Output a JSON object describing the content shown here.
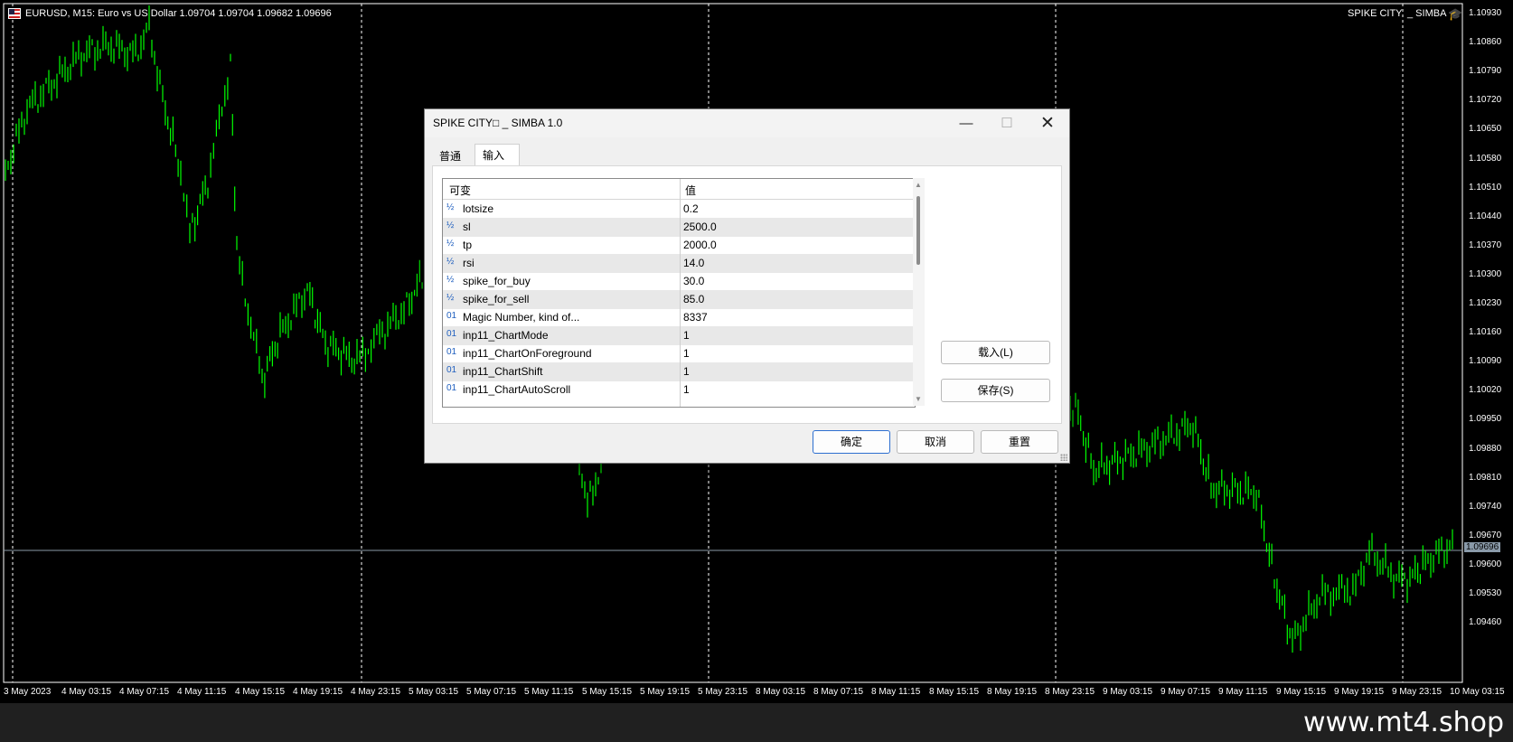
{
  "chart": {
    "header": "EURUSD, M15:  Euro vs US Dollar  1.09704 1.09704 1.09682 1.09696",
    "ea_name": "SPIKE CITY",
    "ea_author": "_ SIMBA",
    "ea_icon": "graduation-cap-icon",
    "current_price": "1.09696",
    "price_ticks": [
      "1.10930",
      "1.10860",
      "1.10790",
      "1.10720",
      "1.10650",
      "1.10580",
      "1.10510",
      "1.10440",
      "1.10370",
      "1.10300",
      "1.10230",
      "1.10160",
      "1.10090",
      "1.10020",
      "1.09950",
      "1.09880",
      "1.09810",
      "1.09740",
      "1.09670",
      "1.09600",
      "1.09530",
      "1.09460"
    ],
    "time_ticks": [
      "3 May 2023",
      "4 May 03:15",
      "4 May 07:15",
      "4 May 11:15",
      "4 May 15:15",
      "4 May 19:15",
      "4 May 23:15",
      "5 May 03:15",
      "5 May 07:15",
      "5 May 11:15",
      "5 May 15:15",
      "5 May 19:15",
      "5 May 23:15",
      "8 May 03:15",
      "8 May 07:15",
      "8 May 11:15",
      "8 May 15:15",
      "8 May 19:15",
      "8 May 23:15",
      "9 May 03:15",
      "9 May 07:15",
      "9 May 11:15",
      "9 May 15:15",
      "9 May 19:15",
      "9 May 23:15",
      "10 May 03:15"
    ],
    "colors": {
      "background": "#000000",
      "candles": "#00ff00",
      "grid": "#ffffff",
      "price_line": "#8a9aa9"
    }
  },
  "dialog": {
    "title": "SPIKE CITY□ _ SIMBA 1.0",
    "window_buttons": {
      "minimize": "—",
      "maximize": "☐",
      "close": "✕"
    },
    "tabs": [
      {
        "label": "普通"
      },
      {
        "label": "输入"
      }
    ],
    "active_tab": "输入",
    "grid": {
      "col_variable": "可变",
      "col_value": "值",
      "rows": [
        {
          "icon": "½",
          "name": "lotsize",
          "value": "0.2"
        },
        {
          "icon": "½",
          "name": "sl",
          "value": "2500.0"
        },
        {
          "icon": "½",
          "name": "tp",
          "value": "2000.0"
        },
        {
          "icon": "½",
          "name": "rsi",
          "value": "14.0"
        },
        {
          "icon": "½",
          "name": "spike_for_buy",
          "value": "30.0"
        },
        {
          "icon": "½",
          "name": "spike_for_sell",
          "value": "85.0"
        },
        {
          "icon": "01",
          "name": "Magic Number, kind of...",
          "value": "8337"
        },
        {
          "icon": "01",
          "name": "inp11_ChartMode",
          "value": "1"
        },
        {
          "icon": "01",
          "name": "inp11_ChartOnForeground",
          "value": "1"
        },
        {
          "icon": "01",
          "name": "inp11_ChartShift",
          "value": "1"
        },
        {
          "icon": "01",
          "name": "inp11_ChartAutoScroll",
          "value": "1"
        }
      ]
    },
    "buttons": {
      "load": "载入(L)",
      "save": "保存(S)",
      "ok": "确定",
      "cancel": "取消",
      "reset": "重置"
    }
  },
  "watermark": "www.mt4.shop"
}
